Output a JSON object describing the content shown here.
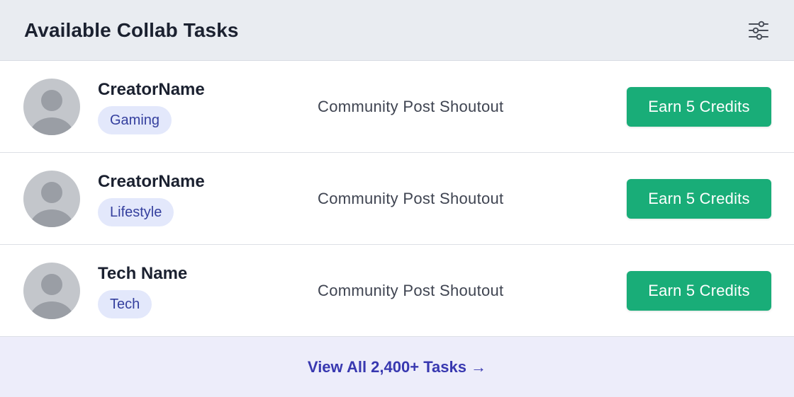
{
  "header": {
    "title": "Available Collab Tasks",
    "filter_icon": "sliders-icon"
  },
  "tasks": [
    {
      "name": "CreatorName",
      "category": "Gaming",
      "task": "Community Post Shoutout",
      "button": "Earn 5 Credits"
    },
    {
      "name": "CreatorName",
      "category": "Lifestyle",
      "task": "Community Post Shoutout",
      "button": "Earn 5 Credits"
    },
    {
      "name": "Tech Name",
      "category": "Tech",
      "task": "Community Post Shoutout",
      "button": "Earn 5 Credits"
    }
  ],
  "footer": {
    "view_all": "View All 2,400+ Tasks →"
  },
  "colors": {
    "accent_green": "#19ad78",
    "tag_bg": "#e3e8fb",
    "tag_text": "#343f9e",
    "link": "#3838b0",
    "header_bg": "#e9ecf1"
  }
}
